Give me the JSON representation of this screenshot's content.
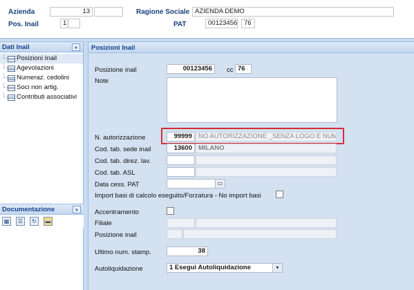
{
  "header": {
    "azienda_label": "Azienda",
    "azienda_code": "13",
    "azienda_extra": "",
    "ragione_label": "Ragione Sociale",
    "ragione_value": "AZIENDA DEMO",
    "pos_label": "Pos. Inail",
    "pos_value": "1",
    "pos_extra": "",
    "pat_label": "PAT",
    "pat_value": "00123456",
    "pat_cc": "76"
  },
  "sidebar": {
    "title": "Dati Inail",
    "collapse_icon": "double-chevron-left-icon",
    "items": [
      {
        "label": "Posizioni Inail",
        "selected": true
      },
      {
        "label": "Agevolazioni"
      },
      {
        "label": "Numeraz. cedolini"
      },
      {
        "label": "Soci non artig."
      },
      {
        "label": "Contributi associativi"
      }
    ]
  },
  "documentazione": {
    "title": "Documentazione",
    "collapse_icon": "double-chevron-down-icon",
    "tools": [
      "grid-icon",
      "list-icon",
      "refresh-icon",
      "folder-icon"
    ]
  },
  "main": {
    "title": "Posizioni Inail",
    "fields": {
      "posizione_label": "Posizione inail",
      "posizione_value": "00123456",
      "cc_label": "cc",
      "cc_value": "76",
      "note_label": "Note",
      "note_value": "",
      "autorizzazione_label": "N. autorizzazione",
      "autorizzazione_code": "99999",
      "autorizzazione_desc": "NO AUTORIZZAZIONE _SENZA LOGO E NUMERA",
      "sede_label": "Cod. tab. sede inail",
      "sede_code": "13600",
      "sede_desc": "MILANO",
      "direz_label": "Cod. tab. direz. lav.",
      "asl_label": "Cod. tab. ASL",
      "cess_label": "Data cess. PAT",
      "import_label": "Import basi di calcolo eseguito/Forzatura - No import basi",
      "accentramento_label": "Accentramento",
      "filiale_label": "Filiale",
      "posizione2_label": "Posizione inail",
      "ultimo_label": "Ultimo num. stamp.",
      "ultimo_value": "38",
      "autoliq_label": "Autoliquidazione",
      "autoliq_value": "1 Esegui Autoliquidazione"
    }
  },
  "colors": {
    "highlight": "#d32f2f",
    "title_text": "#15428b"
  }
}
